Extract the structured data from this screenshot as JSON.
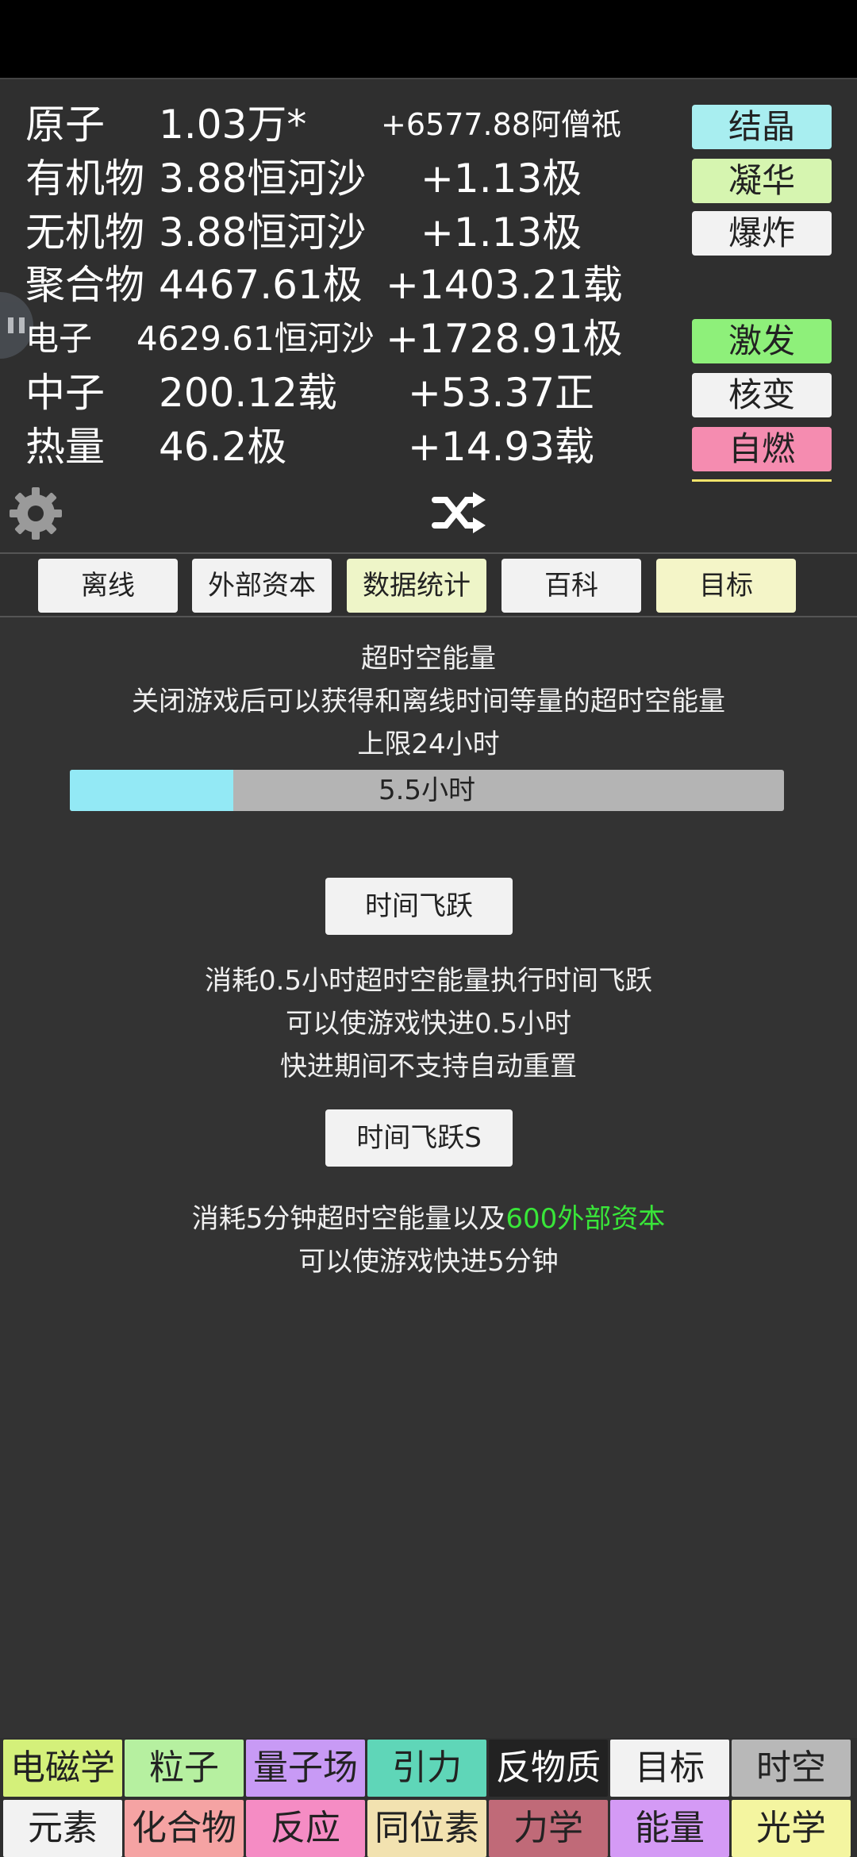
{
  "resources": [
    {
      "name": "原子",
      "value": "1.03万*",
      "rate": "+6577.88阿僧祇"
    },
    {
      "name": "有机物",
      "value": "3.88恒河沙",
      "rate": "+1.13极"
    },
    {
      "name": "无机物",
      "value": "3.88恒河沙",
      "rate": "+1.13极"
    },
    {
      "name": "聚合物",
      "value": "4467.61极",
      "rate": "+1403.21载"
    },
    {
      "name": "电子",
      "value": "4629.61恒河沙",
      "rate": "+1728.91极"
    },
    {
      "name": "中子",
      "value": "200.12载",
      "rate": "+53.37正"
    },
    {
      "name": "热量",
      "value": "46.2极",
      "rate": "+14.93载"
    }
  ],
  "actions": [
    {
      "label": "结晶",
      "color": "#a8eef0"
    },
    {
      "label": "凝华",
      "color": "#d6f5b0"
    },
    {
      "label": "爆炸",
      "color": "#f2f2f2"
    },
    {
      "label": "激发",
      "color": "#8ef07a"
    },
    {
      "label": "核变",
      "color": "#f2f2f2"
    },
    {
      "label": "自燃",
      "color": "#f58cb0"
    }
  ],
  "tabs": [
    {
      "label": "离线",
      "color": "#f2f2f2"
    },
    {
      "label": "外部资本",
      "color": "#f2f2f2"
    },
    {
      "label": "数据统计",
      "color": "#eef5c8"
    },
    {
      "label": "百科",
      "color": "#f2f2f2"
    },
    {
      "label": "目标",
      "color": "#f4f5c8"
    }
  ],
  "offline": {
    "title": "超时空能量",
    "desc": "关闭游戏后可以获得和离线时间等量的超时空能量",
    "limit": "上限24小时",
    "progress_label": "5.5小时",
    "progress_fraction": 0.229,
    "jump_button": "时间飞跃",
    "jump_desc1": "消耗0.5小时超时空能量执行时间飞跃",
    "jump_desc2": "可以使游戏快进0.5小时",
    "jump_desc3": "快进期间不支持自动重置",
    "jump_s_button": "时间飞跃S",
    "jump_s_desc_a": "消耗5分钟超时空能量以及",
    "jump_s_desc_b": "600外部资本",
    "jump_s_desc2": "可以使游戏快进5分钟"
  },
  "bottom_nav": [
    [
      {
        "label": "电磁学",
        "color": "#d4f07a"
      },
      {
        "label": "粒子",
        "color": "#b6f0a0"
      },
      {
        "label": "量子场",
        "color": "#c89af5"
      },
      {
        "label": "引力",
        "color": "#5fd6b8"
      },
      {
        "label": "反物质",
        "color": "#222222",
        "text": "#ffffff"
      },
      {
        "label": "目标",
        "color": "#f2f2f2"
      },
      {
        "label": "时空",
        "color": "#b8b8b8"
      }
    ],
    [
      {
        "label": "元素",
        "color": "#f2f2f2"
      },
      {
        "label": "化合物",
        "color": "#f5a3a3"
      },
      {
        "label": "反应",
        "color": "#f58cc4"
      },
      {
        "label": "同位素",
        "color": "#f2e2b0"
      },
      {
        "label": "力学",
        "color": "#c06a78"
      },
      {
        "label": "能量",
        "color": "#d49af5"
      },
      {
        "label": "光学",
        "color": "#f4f5a0"
      }
    ]
  ]
}
